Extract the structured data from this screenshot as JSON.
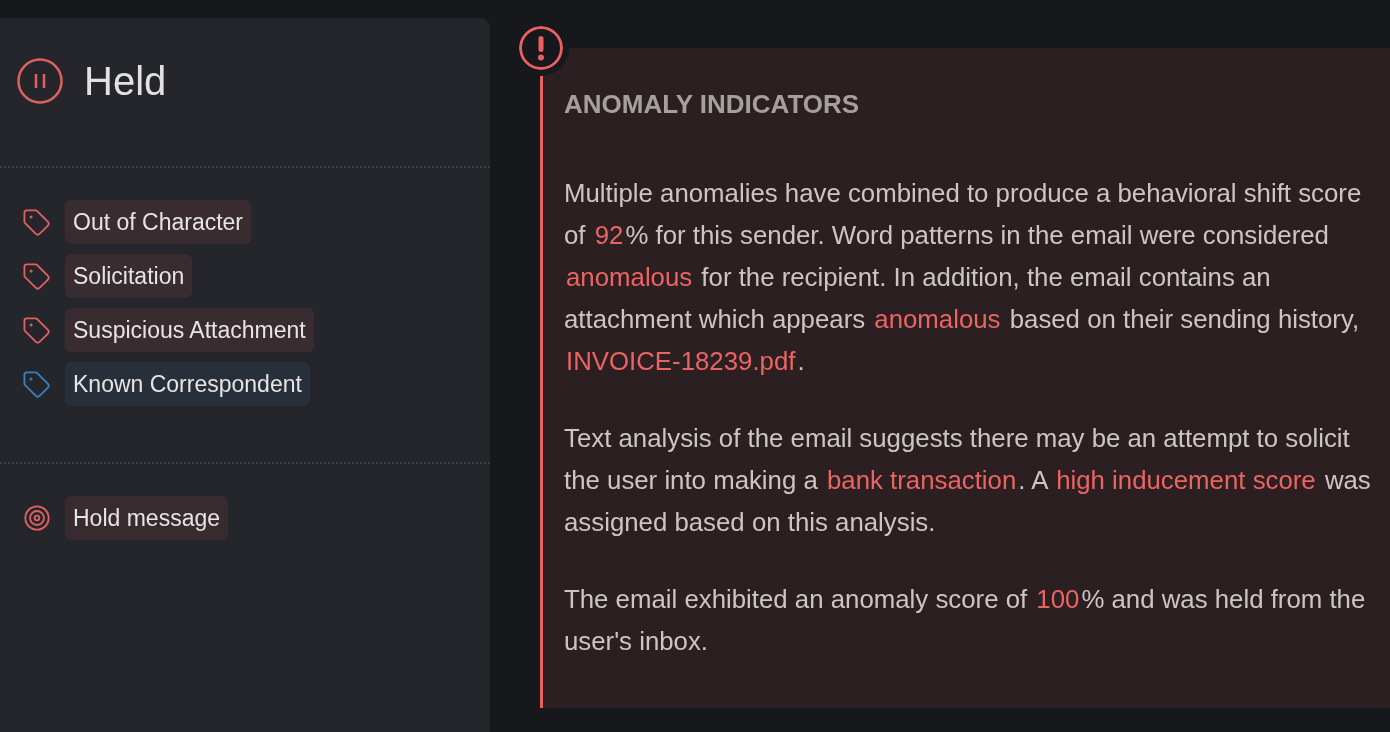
{
  "status": {
    "label": "Held"
  },
  "tags": [
    {
      "label": "Out of Character",
      "color": "#e0605f"
    },
    {
      "label": "Solicitation",
      "color": "#e0605f"
    },
    {
      "label": "Suspicious Attachment",
      "color": "#e0605f"
    },
    {
      "label": "Known Correspondent",
      "color": "#3a80c0"
    }
  ],
  "actions": [
    {
      "label": "Hold message"
    }
  ],
  "alert": {
    "title": "ANOMALY INDICATORS",
    "paragraphs": [
      [
        {
          "text": "Multiple anomalies have combined to produce a behavioral shift score of ",
          "highlighted": false
        },
        {
          "text": "92",
          "highlighted": true
        },
        {
          "text": "% for this sender. Word patterns in the email were considered ",
          "highlighted": false
        },
        {
          "text": "anomalous",
          "highlighted": true
        },
        {
          "text": " for the recipient. In addition, the email contains an attachment which appears ",
          "highlighted": false
        },
        {
          "text": "anomalous",
          "highlighted": true
        },
        {
          "text": " based on their sending history, ",
          "highlighted": false
        },
        {
          "text": "INVOICE-18239.pdf",
          "highlighted": true
        },
        {
          "text": ".",
          "highlighted": false
        }
      ],
      [
        {
          "text": "Text analysis of the email suggests there may be an attempt to solicit the user into making a ",
          "highlighted": false
        },
        {
          "text": "bank transaction",
          "highlighted": true
        },
        {
          "text": ". A ",
          "highlighted": false
        },
        {
          "text": "high inducement score",
          "highlighted": true
        },
        {
          "text": " was assigned based on this analysis.",
          "highlighted": false
        }
      ],
      [
        {
          "text": "The email exhibited an anomaly score of ",
          "highlighted": false
        },
        {
          "text": "100",
          "highlighted": true
        },
        {
          "text": "% and was held from the user's inbox.",
          "highlighted": false
        }
      ]
    ]
  }
}
